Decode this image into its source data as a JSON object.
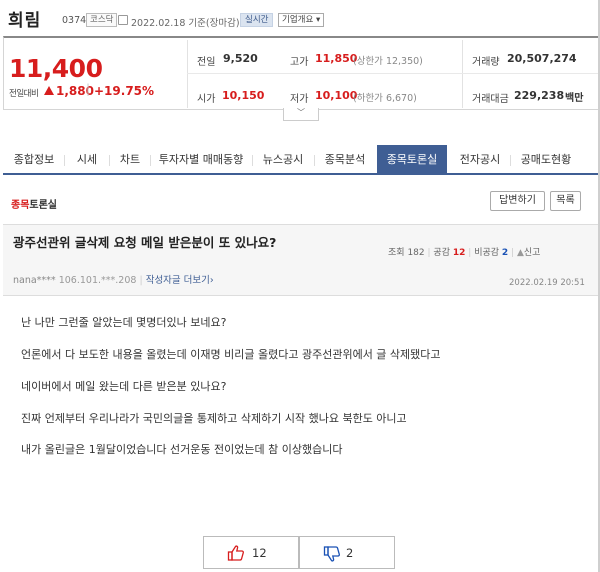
{
  "header": {
    "name": "희림",
    "code": "037440",
    "market_badge": "코스닥",
    "date_text": "2022.02.18 기준(장마감)",
    "realtime_badge": "실시간",
    "company_badge": "기업개요 ▾"
  },
  "price": {
    "current": "11,400",
    "prev_diff_label": "전일대비",
    "diff": "1,880",
    "diff_pct": "+19.75%",
    "separator": "|"
  },
  "quotes": {
    "prev_close_label": "전일",
    "prev_close": "9,520",
    "high_label": "고가",
    "high": "11,850",
    "upper_limit": "(상한가 12,350)",
    "volume_label": "거래량",
    "volume": "20,507,274",
    "open_label": "시가",
    "open": "10,150",
    "low_label": "저가",
    "low": "10,100",
    "lower_limit": "(하한가 6,670)",
    "amount_label": "거래대금",
    "amount": "229,238",
    "amount_unit": "백만"
  },
  "expand_icon": "chevron-down-icon",
  "tabs": [
    {
      "label": "종합정보"
    },
    {
      "label": "시세"
    },
    {
      "label": "차트"
    },
    {
      "label": "투자자별 매매동향"
    },
    {
      "label": "뉴스공시"
    },
    {
      "label": "종목분석"
    },
    {
      "label": "종목토론실"
    },
    {
      "label": "전자공시"
    },
    {
      "label": "공매도현황"
    }
  ],
  "board": {
    "title_em": "종목",
    "title_rest": "토론실",
    "reply_button": "답변하기",
    "list_button": "목록"
  },
  "post": {
    "title": "광주선관위 글삭제 요청 메일 받은분이 또 있나요?",
    "views_label": "조회",
    "views": "182",
    "likes_label": "공감",
    "likes": "12",
    "dislikes_label": "비공감",
    "dislikes": "2",
    "report_label": "신고",
    "author_nick": "nana****",
    "author_ip": "106.101.***.208",
    "more_posts": "작성자글 더보기",
    "date": "2022.02.19 20:51",
    "lines": [
      "난 나만 그런줄 알았는데 몇명더있나 보네요?",
      "언론에서 다 보도한 내용을 올렸는데 이재명 비리글 올렸다고 광주선관위에서 글 삭제됐다고",
      "네이버에서 메일 왔는데 다른 받은분 있나요?",
      "진짜 언제부터 우리나라가 국민의글을 통제하고 삭제하기 시작 했나요 북한도 아니고",
      "내가 올린글은 1월달이었습니다 선거운동 전이었는데 참 이상했습니다"
    ]
  },
  "votes": {
    "up_icon": "thumbs-up-icon",
    "up_count": "12",
    "down_icon": "thumbs-down-icon",
    "down_count": "2"
  },
  "colors": {
    "up_red": "#d71d1d",
    "down_blue": "#1a52b5",
    "tab_active": "#3f5e94"
  }
}
